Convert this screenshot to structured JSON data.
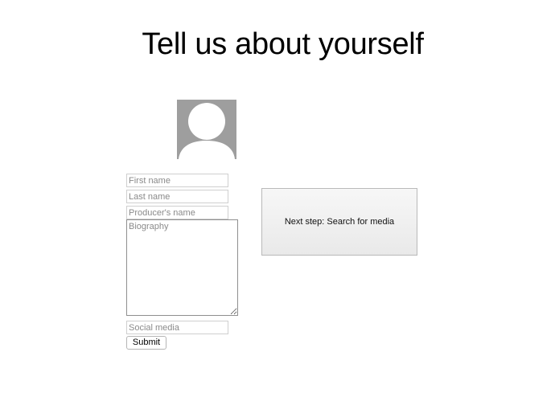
{
  "page": {
    "title": "Tell us about yourself"
  },
  "avatar": {
    "icon": "user-silhouette-icon",
    "background_color": "#9e9e9e",
    "figure_color": "#ffffff"
  },
  "form": {
    "first_name": {
      "placeholder": "First name",
      "value": ""
    },
    "last_name": {
      "placeholder": "Last name",
      "value": ""
    },
    "producer_name": {
      "placeholder": "Producer's name",
      "value": ""
    },
    "biography": {
      "placeholder": "Biography",
      "value": ""
    },
    "social_media": {
      "placeholder": "Social media",
      "value": ""
    },
    "submit_label": "Submit"
  },
  "next_step": {
    "label": "Next step: Search for media"
  }
}
